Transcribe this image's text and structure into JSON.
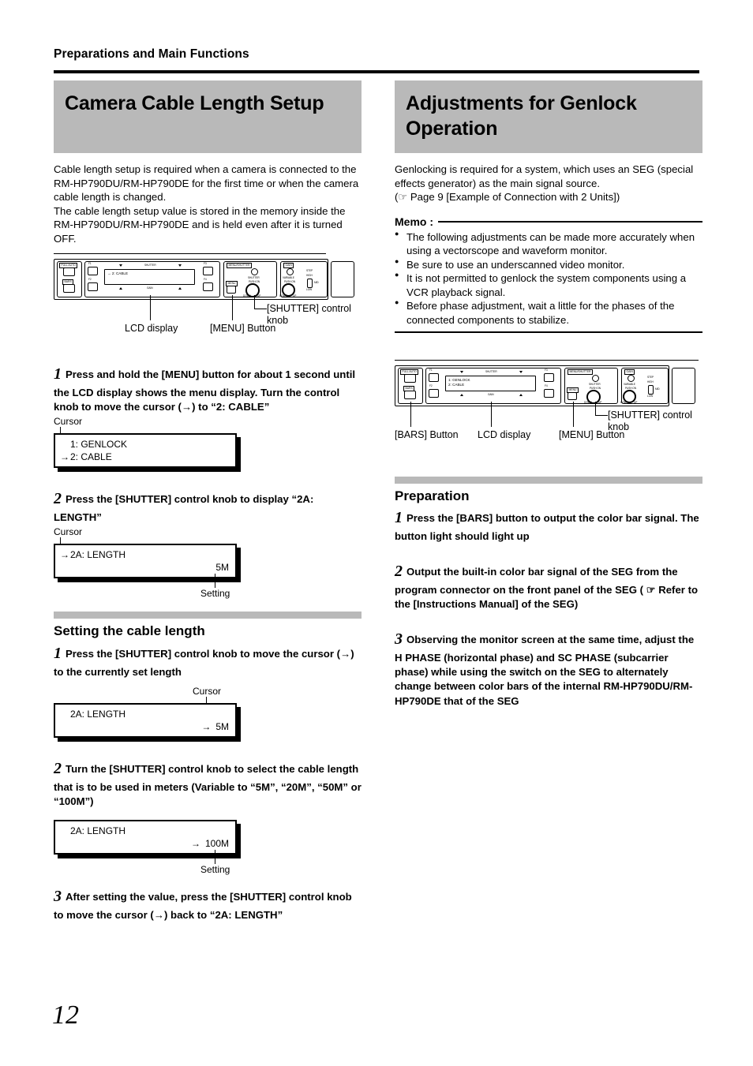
{
  "header": {
    "running_title": "Preparations and Main Functions"
  },
  "page_number": "12",
  "left_column": {
    "title": "Camera Cable Length Setup",
    "intro_paragraph_1": "Cable length setup is required when a camera is connected to the RM-HP790DU/RM-HP790DE for the first time or when the camera cable length is changed.",
    "intro_paragraph_2": "The cable length setup value is stored in the memory inside the RM-HP790DU/RM-HP790DE and is held even after it is turned OFF.",
    "figure": {
      "lcd_text": "→ 2: CABLE",
      "panel_labels": {
        "full_auto": "FULL AUTO",
        "bars": "BARS",
        "f1": "F1",
        "f2": "F2",
        "f3": "F3",
        "f4": "F4",
        "shutter_top": "SHUTTER",
        "gain_bottom": "GAIN",
        "menu_shutter_group": "MENU/SHUTTER",
        "menu": "MENU",
        "shutter": "SHUTTER",
        "push_on": "PUSH ON",
        "down": "DOWN",
        "up": "UP",
        "gain_group": "GAIN",
        "variable": "VARIABLE",
        "step": "STEP",
        "high": "HIGH",
        "low": "LOW",
        "mid": "MID"
      },
      "callouts": [
        "LCD display",
        "[MENU] Button",
        "[SHUTTER] control knob"
      ]
    },
    "steps": [
      {
        "num": "1",
        "text": "Press and hold the [MENU] button for about 1 second until the LCD display shows the menu display. Turn the control knob to move the cursor (→) to “2: CABLE”"
      },
      {
        "num": "2",
        "text": "Press the [SHUTTER] control knob to display “2A: LENGTH”"
      }
    ],
    "lcd_example_1": {
      "cursor_label": "Cursor",
      "line1_cursor": "",
      "line1": "1: GENLOCK",
      "line2_cursor": "→",
      "line2": "2: CABLE"
    },
    "lcd_example_2": {
      "cursor_label": "Cursor",
      "setting_label": "Setting",
      "line1_cursor": "→",
      "line1": "2A: LENGTH",
      "value": "5M"
    },
    "subsection": {
      "title": "Setting the cable length",
      "steps": [
        {
          "num": "1",
          "text": "Press the [SHUTTER] control knob to move the cursor (→) to the currently set length"
        },
        {
          "num": "2",
          "text": "Turn the [SHUTTER] control knob to select the cable length that is to be used in meters (Variable to “5M”, “20M”, “50M” or “100M”)"
        },
        {
          "num": "3",
          "text": "After setting the value, press the [SHUTTER] control knob to move the cursor (→) back to “2A: LENGTH”"
        }
      ],
      "lcd_example_3": {
        "cursor_label": "Cursor",
        "line1": "2A: LENGTH",
        "value_cursor": "→",
        "value": "5M"
      },
      "lcd_example_4": {
        "setting_label": "Setting",
        "line1": "2A: LENGTH",
        "value_cursor": "→",
        "value": "100M"
      }
    }
  },
  "right_column": {
    "title": "Adjustments for Genlock Operation",
    "intro_paragraph_1": "Genlocking is required for a system, which uses an SEG (special effects generator) as the main signal source.",
    "intro_reference": "(☞ Page 9 [Example of Connection with 2 Units])",
    "memo": {
      "label": "Memo :",
      "items": [
        "The following adjustments can be made more accurately when using a vectorscope and waveform monitor.",
        "Be sure to use an underscanned video monitor.",
        "It is not permitted to genlock the system components using a VCR playback signal.",
        "Before phase adjustment, wait a little for the phases of the connected components to stabilize."
      ]
    },
    "figure": {
      "lcd_line1": "1: GENLOCK",
      "lcd_line2": "2: CABLE",
      "callouts": [
        "[BARS] Button",
        "LCD display",
        "[MENU] Button",
        "[SHUTTER] control knob"
      ]
    },
    "preparation": {
      "title": "Preparation",
      "steps": [
        {
          "num": "1",
          "text": "Press the [BARS] button to output the color bar signal. The button light should light up"
        },
        {
          "num": "2",
          "text": "Output the built-in color bar signal of the SEG from the program connector on the front panel of the SEG ( ☞ Refer to the [Instructions Manual] of the SEG)"
        },
        {
          "num": "3",
          "text": "Observing the monitor screen at the same time, adjust the H PHASE (horizontal phase) and SC PHASE (subcarrier phase) while using the switch on the SEG to alternately change between color bars of the internal RM-HP790DU/RM-HP790DE that of the SEG"
        }
      ]
    }
  }
}
